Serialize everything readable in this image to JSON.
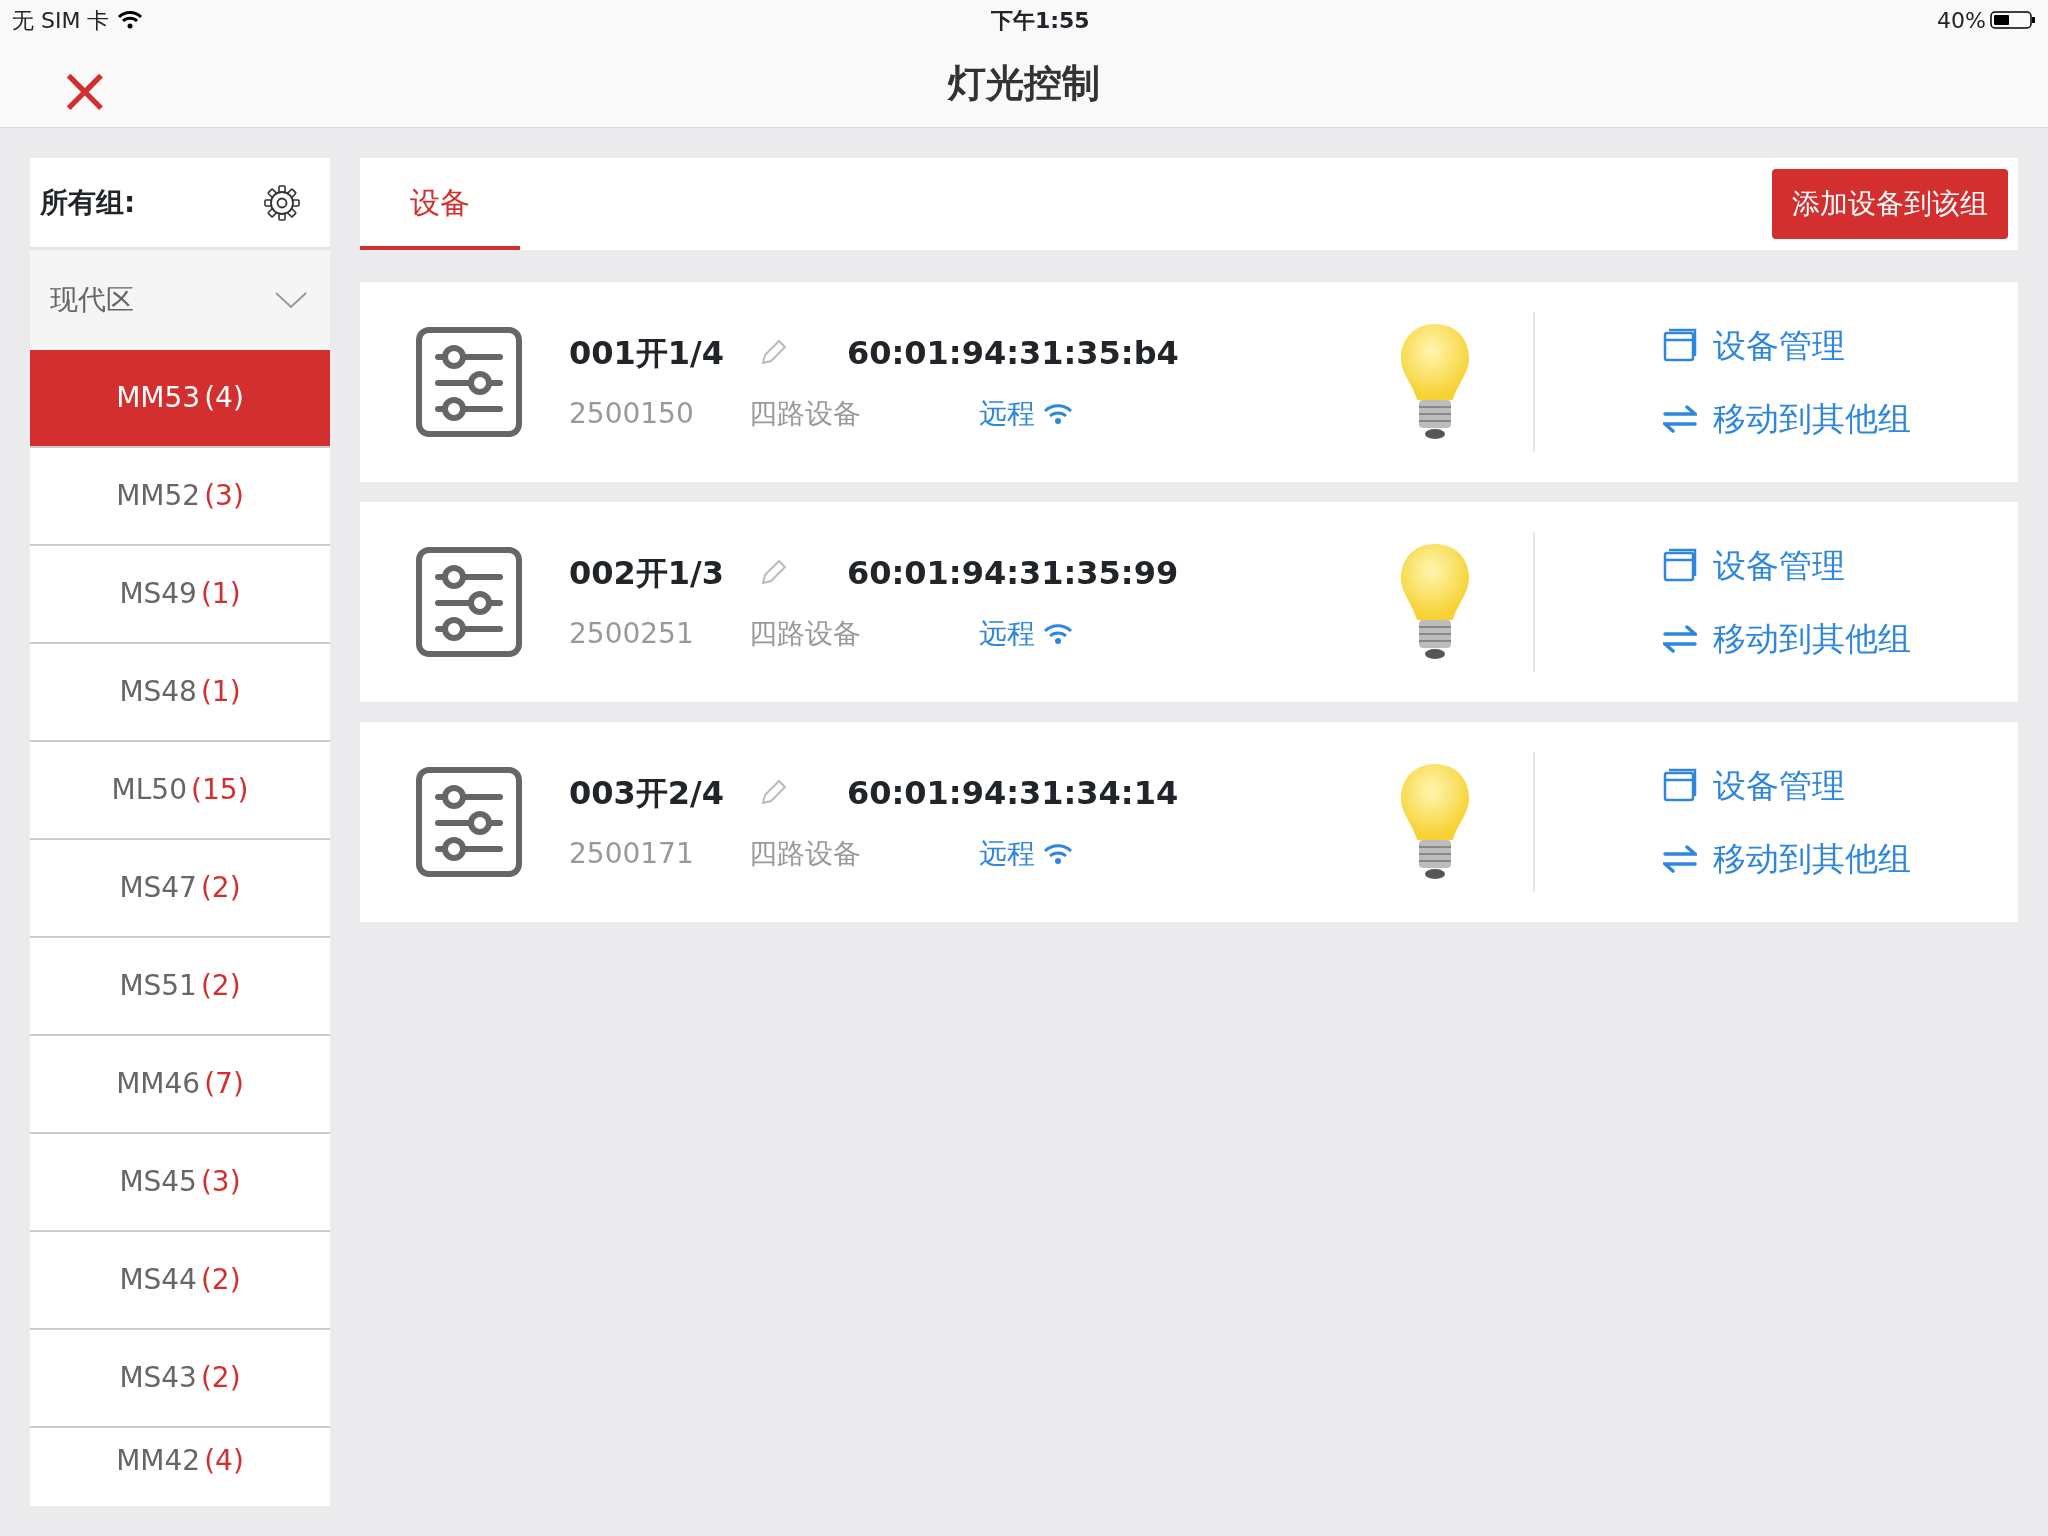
{
  "status_bar": {
    "carrier": "无 SIM 卡",
    "time": "下午1:55",
    "battery": "40%"
  },
  "nav": {
    "close": "×",
    "title": "灯光控制"
  },
  "sidebar": {
    "title": "所有组:",
    "area": {
      "label": "现代区",
      "expanded": true
    },
    "groups": [
      {
        "name": "MM53",
        "count": "(4)",
        "selected": true
      },
      {
        "name": "MM52",
        "count": "(3)",
        "selected": false
      },
      {
        "name": "MS49",
        "count": "(1)",
        "selected": false
      },
      {
        "name": "MS48",
        "count": "(1)",
        "selected": false
      },
      {
        "name": "ML50",
        "count": "(15)",
        "selected": false
      },
      {
        "name": "MS47",
        "count": "(2)",
        "selected": false
      },
      {
        "name": "MS51",
        "count": "(2)",
        "selected": false
      },
      {
        "name": "MM46",
        "count": "(7)",
        "selected": false
      },
      {
        "name": "MS45",
        "count": "(3)",
        "selected": false
      },
      {
        "name": "MS44",
        "count": "(2)",
        "selected": false
      },
      {
        "name": "MS43",
        "count": "(2)",
        "selected": false
      },
      {
        "name": "MM42",
        "count": "(4)",
        "selected": false
      }
    ]
  },
  "tabs": [
    {
      "label": "设备",
      "selected": true
    }
  ],
  "add_button": "添加设备到该组",
  "devices": [
    {
      "name": "001开1/4",
      "mac": "60:01:94:31:35:b4",
      "id": "2500150",
      "type": "四路设备",
      "connection": "远程",
      "on": true,
      "actions": [
        "设备管理",
        "移动到其他组"
      ]
    },
    {
      "name": "002开1/3",
      "mac": "60:01:94:31:35:99",
      "id": "2500251",
      "type": "四路设备",
      "connection": "远程",
      "on": true,
      "actions": [
        "设备管理",
        "移动到其他组"
      ]
    },
    {
      "name": "003开2/4",
      "mac": "60:01:94:31:34:14",
      "id": "2500171",
      "type": "四路设备",
      "connection": "远程",
      "on": true,
      "actions": [
        "设备管理",
        "移动到其他组"
      ]
    }
  ]
}
